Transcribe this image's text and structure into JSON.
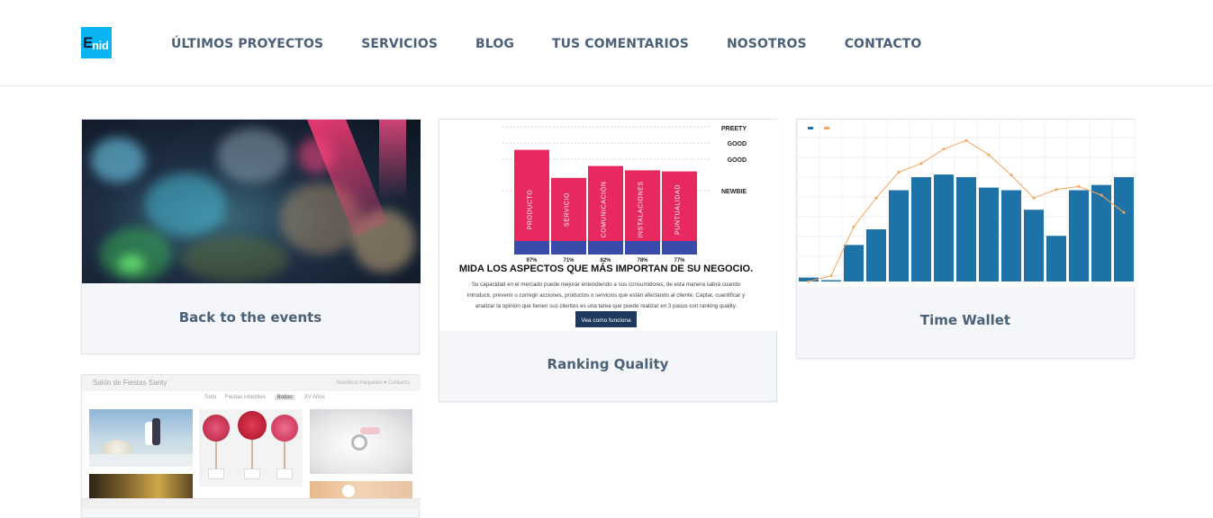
{
  "brand": {
    "logo_big": "E",
    "logo_small": "nid"
  },
  "nav": [
    {
      "label": "ÚLTIMOS PROYECTOS"
    },
    {
      "label": "SERVICIOS"
    },
    {
      "label": "BLOG"
    },
    {
      "label": "TUS COMENTARIOS"
    },
    {
      "label": "NOSOTROS"
    },
    {
      "label": "CONTACTO"
    }
  ],
  "cards": [
    {
      "title": "Back to the events"
    },
    {
      "title": "Ranking Quality"
    },
    {
      "title": "Time Wallet"
    }
  ],
  "ranking_image": {
    "bars": [
      {
        "label": "PRODUCTO",
        "pct": "97%",
        "value": 97
      },
      {
        "label": "SERVICIO",
        "pct": "71%",
        "value": 71
      },
      {
        "label": "COMUNICACIÓN",
        "pct": "82%",
        "value": 82
      },
      {
        "label": "INSTALACIONES",
        "pct": "78%",
        "value": 78
      },
      {
        "label": "PUNTUALIDAD",
        "pct": "77%",
        "value": 77
      }
    ],
    "levels": [
      "PREETY",
      "GOOD",
      "GOOD",
      "NEWBIE"
    ],
    "headline": "MIDA LOS ASPECTOS QUE MÁS IMPORTAN DE SU NEGOCIO.",
    "body_lines": [
      "Su capacidad en el mercado puede mejorar entendiendo a sus consumidores, de esta manera sabrá cuando",
      "introducir, prevenir o corregir acciones, productos o servicios que están afectando al cliente. Captar, cuantificar y",
      "analizar la opinión que tienen sus clientes es una tarea que puede realizar en 3 pasos con ranking quality."
    ],
    "cta": "Vea como funciona",
    "colors": {
      "bar": "#e8295f",
      "base": "#3a4aa8",
      "cta": "#1d3a5e"
    }
  },
  "wallet_image": {
    "bars": [
      3,
      1,
      28,
      40,
      70,
      80,
      82,
      80,
      72,
      70,
      55,
      35,
      70,
      74,
      80
    ],
    "line": [
      0,
      4,
      38,
      58,
      76,
      82,
      92,
      98,
      88,
      74,
      58,
      64,
      66,
      60,
      48
    ],
    "colors": {
      "bar": "#1d73a8",
      "line": "#f6a55c"
    }
  },
  "wedding_image": {
    "site_title": "Salón de Fiestas Santy",
    "links": "Nosotros     Paquetes ▾     Contacto",
    "filters": [
      "Todo",
      "Fiestas infantiles",
      "Bodas",
      "XV Años"
    ],
    "active_filter": "Bodas"
  }
}
